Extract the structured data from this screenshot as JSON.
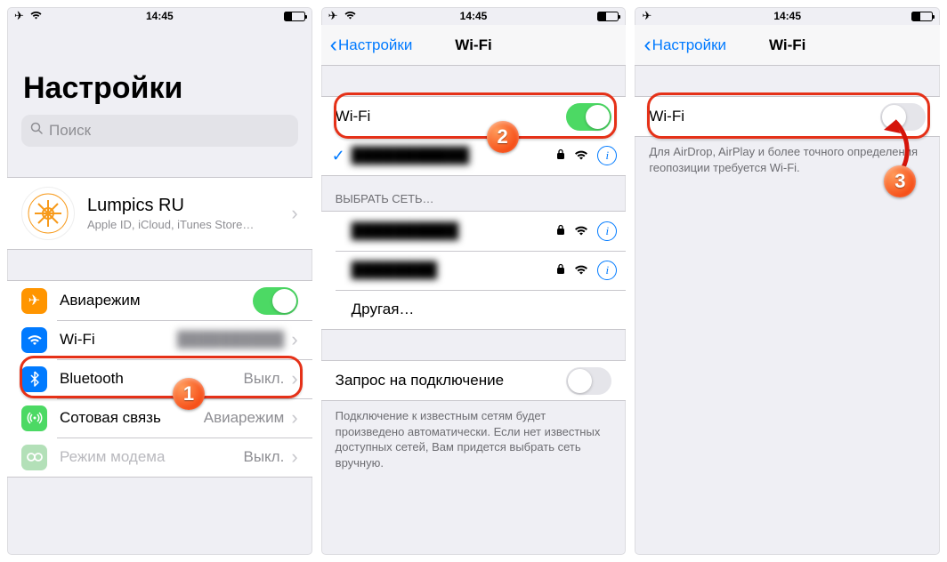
{
  "statusbar": {
    "time": "14:45"
  },
  "screen1": {
    "title": "Настройки",
    "search_placeholder": "Поиск",
    "account": {
      "name": "Lumpics RU",
      "sub": "Apple ID, iCloud, iTunes Store…"
    },
    "rows": {
      "airplane": "Авиарежим",
      "wifi": "Wi-Fi",
      "bluetooth": "Bluetooth",
      "bluetooth_value": "Выкл.",
      "cellular": "Сотовая связь",
      "cellular_value": "Авиарежим",
      "hotspot": "Режим модема",
      "hotspot_value": "Выкл."
    }
  },
  "screen2": {
    "back": "Настройки",
    "title": "Wi-Fi",
    "wifi_label": "Wi-Fi",
    "choose_header": "ВЫБРАТЬ СЕТЬ…",
    "other": "Другая…",
    "ask_label": "Запрос на подключение",
    "ask_footer": "Подключение к известным сетям будет произведено автоматически. Если нет известных доступных сетей, Вам придется выбрать сеть вручную."
  },
  "screen3": {
    "back": "Настройки",
    "title": "Wi-Fi",
    "wifi_label": "Wi-Fi",
    "footer": "Для AirDrop, AirPlay и более точного определения геопозиции требуется Wi-Fi."
  },
  "badges": {
    "b1": "1",
    "b2": "2",
    "b3": "3"
  }
}
